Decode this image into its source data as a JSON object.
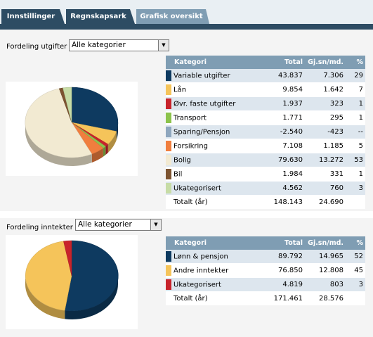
{
  "tabs": [
    {
      "label": "Innstillinger",
      "active": false
    },
    {
      "label": "Regnskapsark",
      "active": false
    },
    {
      "label": "Grafisk oversikt",
      "active": true
    }
  ],
  "expenses": {
    "filter_label": "Fordeling utgifter",
    "filter_value": "Alle kategorier",
    "headers": {
      "category": "Kategori",
      "total": "Total",
      "avg": "Gj.sn/md.",
      "pct": "%"
    },
    "rows": [
      {
        "name": "Variable utgifter",
        "total": "43.837",
        "avg": "7.306",
        "pct": "29",
        "color": "#0e3a60"
      },
      {
        "name": "Lån",
        "total": "9.854",
        "avg": "1.642",
        "pct": "7",
        "color": "#f5c45a"
      },
      {
        "name": "Øvr. faste utgifter",
        "total": "1.937",
        "avg": "323",
        "pct": "1",
        "color": "#c8232b"
      },
      {
        "name": "Transport",
        "total": "1.771",
        "avg": "295",
        "pct": "1",
        "color": "#8cc34b"
      },
      {
        "name": "Sparing/Pensjon",
        "total": "-2.540",
        "avg": "-423",
        "pct": "--",
        "color": "#8fa7be"
      },
      {
        "name": "Forsikring",
        "total": "7.108",
        "avg": "1.185",
        "pct": "5",
        "color": "#f07e3e"
      },
      {
        "name": "Bolig",
        "total": "79.630",
        "avg": "13.272",
        "pct": "53",
        "color": "#f2ead2"
      },
      {
        "name": "Bil",
        "total": "1.984",
        "avg": "331",
        "pct": "1",
        "color": "#7d5431"
      },
      {
        "name": "Ukategorisert",
        "total": "4.562",
        "avg": "760",
        "pct": "3",
        "color": "#c7dca6"
      }
    ],
    "total_label": "Totalt (år)",
    "total": "148.143",
    "total_avg": "24.690",
    "pie": [
      {
        "color": "#0e3a60",
        "value": 43837
      },
      {
        "color": "#f5c45a",
        "value": 9854
      },
      {
        "color": "#c8232b",
        "value": 1937
      },
      {
        "color": "#8cc34b",
        "value": 1771
      },
      {
        "color": "#f07e3e",
        "value": 7108
      },
      {
        "color": "#f2ead2",
        "value": 79630
      },
      {
        "color": "#7d5431",
        "value": 1984
      },
      {
        "color": "#c7dca6",
        "value": 4562
      }
    ]
  },
  "income": {
    "filter_label": "Fordeling inntekter",
    "filter_value": "Alle kategorier",
    "headers": {
      "category": "Kategori",
      "total": "Total",
      "avg": "Gj.sn/md.",
      "pct": "%"
    },
    "rows": [
      {
        "name": "Lønn & pensjon",
        "total": "89.792",
        "avg": "14.965",
        "pct": "52",
        "color": "#0e3a60"
      },
      {
        "name": "Andre inntekter",
        "total": "76.850",
        "avg": "12.808",
        "pct": "45",
        "color": "#f5c45a"
      },
      {
        "name": "Ukategorisert",
        "total": "4.819",
        "avg": "803",
        "pct": "3",
        "color": "#c8232b"
      }
    ],
    "total_label": "Totalt (år)",
    "total": "171.461",
    "total_avg": "28.576",
    "pie": [
      {
        "color": "#0e3a60",
        "value": 89792
      },
      {
        "color": "#f5c45a",
        "value": 76850
      },
      {
        "color": "#c8232b",
        "value": 4819
      }
    ]
  }
}
